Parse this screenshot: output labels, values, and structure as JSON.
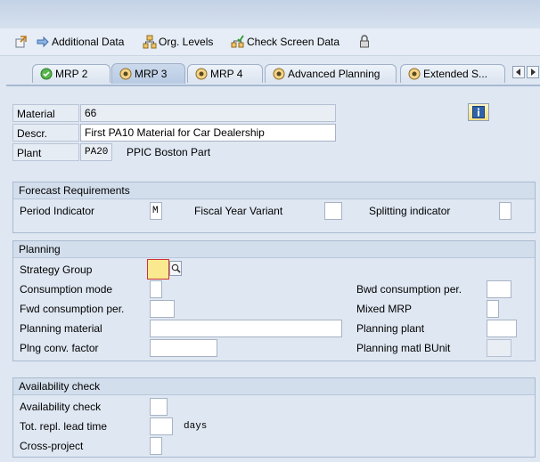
{
  "toolbar": {
    "additional_data": "Additional Data",
    "org_levels": "Org. Levels",
    "check_screen_data": "Check Screen Data"
  },
  "tabs": [
    {
      "label": "MRP 2"
    },
    {
      "label": "MRP 3"
    },
    {
      "label": "MRP 4"
    },
    {
      "label": "Advanced Planning"
    },
    {
      "label": "Extended S..."
    }
  ],
  "header": {
    "material_label": "Material",
    "material_value": "66",
    "descr_label": "Descr.",
    "descr_value": "First PA10 Material for Car Dealership",
    "plant_label": "Plant",
    "plant_value": "PA20",
    "plant_name": "PPIC Boston Part"
  },
  "forecast": {
    "title": "Forecast Requirements",
    "period_indicator_label": "Period Indicator",
    "period_indicator_value": "M",
    "fiscal_year_variant_label": "Fiscal Year Variant",
    "splitting_indicator_label": "Splitting indicator"
  },
  "planning": {
    "title": "Planning",
    "strategy_group_label": "Strategy Group",
    "consumption_mode_label": "Consumption mode",
    "bwd_consumption_label": "Bwd consumption per.",
    "fwd_consumption_label": "Fwd consumption per.",
    "mixed_mrp_label": "Mixed MRP",
    "planning_material_label": "Planning material",
    "planning_plant_label": "Planning plant",
    "plng_conv_factor_label": "Plng conv. factor",
    "planning_matl_bunit_label": "Planning matl BUnit"
  },
  "availability": {
    "title": "Availability check",
    "availability_check_label": "Availability check",
    "tot_repl_lead_time_label": "Tot. repl. lead time",
    "days_unit": "days",
    "cross_project_label": "Cross-project"
  }
}
